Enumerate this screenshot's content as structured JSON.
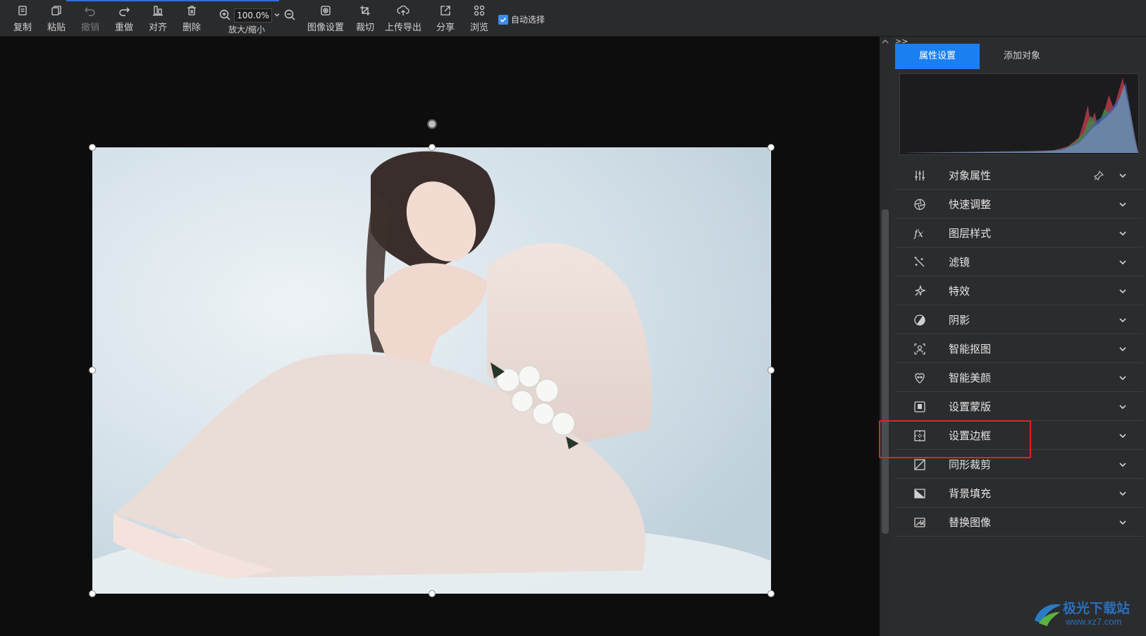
{
  "toolbar": {
    "buttons": [
      {
        "id": "copy",
        "label": "复制",
        "icon": "copy-icon",
        "enabled": true
      },
      {
        "id": "paste",
        "label": "粘贴",
        "icon": "paste-icon",
        "enabled": true
      },
      {
        "id": "undo",
        "label": "撤销",
        "icon": "undo-icon",
        "enabled": false
      },
      {
        "id": "redo",
        "label": "重做",
        "icon": "redo-icon",
        "enabled": true
      },
      {
        "id": "align",
        "label": "对齐",
        "icon": "align-icon",
        "enabled": true
      },
      {
        "id": "delete",
        "label": "删除",
        "icon": "trash-icon",
        "enabled": true
      },
      {
        "id": "image-settings",
        "label": "图像设置",
        "icon": "image-settings-icon",
        "enabled": true
      },
      {
        "id": "crop",
        "label": "裁切",
        "icon": "crop-icon",
        "enabled": true
      },
      {
        "id": "upload-export",
        "label": "上传导出",
        "icon": "upload-icon",
        "enabled": true
      },
      {
        "id": "share",
        "label": "分享",
        "icon": "share-icon",
        "enabled": true
      },
      {
        "id": "browse",
        "label": "浏览",
        "icon": "grid-icon",
        "enabled": true
      }
    ],
    "zoom": {
      "value": "100.0%",
      "label": "放大/缩小"
    },
    "auto_select": {
      "label": "自动选择",
      "checked": true
    }
  },
  "panel": {
    "collapse": ">>",
    "tabs": [
      {
        "label": "属性设置",
        "active": true
      },
      {
        "label": "添加对象",
        "active": false
      }
    ],
    "sections": [
      {
        "label": "对象属性",
        "icon": "sliders-icon",
        "pinned": true
      },
      {
        "label": "快速调整",
        "icon": "aperture-icon"
      },
      {
        "label": "图层样式",
        "icon": "fx-icon"
      },
      {
        "label": "滤镜",
        "icon": "magic-wand-icon"
      },
      {
        "label": "特效",
        "icon": "sparkle-icon"
      },
      {
        "label": "阴影",
        "icon": "shadow-icon"
      },
      {
        "label": "智能抠图",
        "icon": "cutout-icon"
      },
      {
        "label": "智能美颜",
        "icon": "beauty-icon"
      },
      {
        "label": "设置蒙版",
        "icon": "mask-icon"
      },
      {
        "label": "设置边框",
        "icon": "border-icon",
        "highlighted": true
      },
      {
        "label": "同形裁剪",
        "icon": "shape-crop-icon"
      },
      {
        "label": "背景填充",
        "icon": "fill-icon"
      },
      {
        "label": "替换图像",
        "icon": "replace-image-icon"
      }
    ]
  },
  "colors": {
    "accent": "#1a7ff0",
    "highlight": "#e02424",
    "panel_bg": "#2b2c2e"
  },
  "watermark": {
    "title": "极光下载站",
    "url": "www.xz7.com"
  }
}
